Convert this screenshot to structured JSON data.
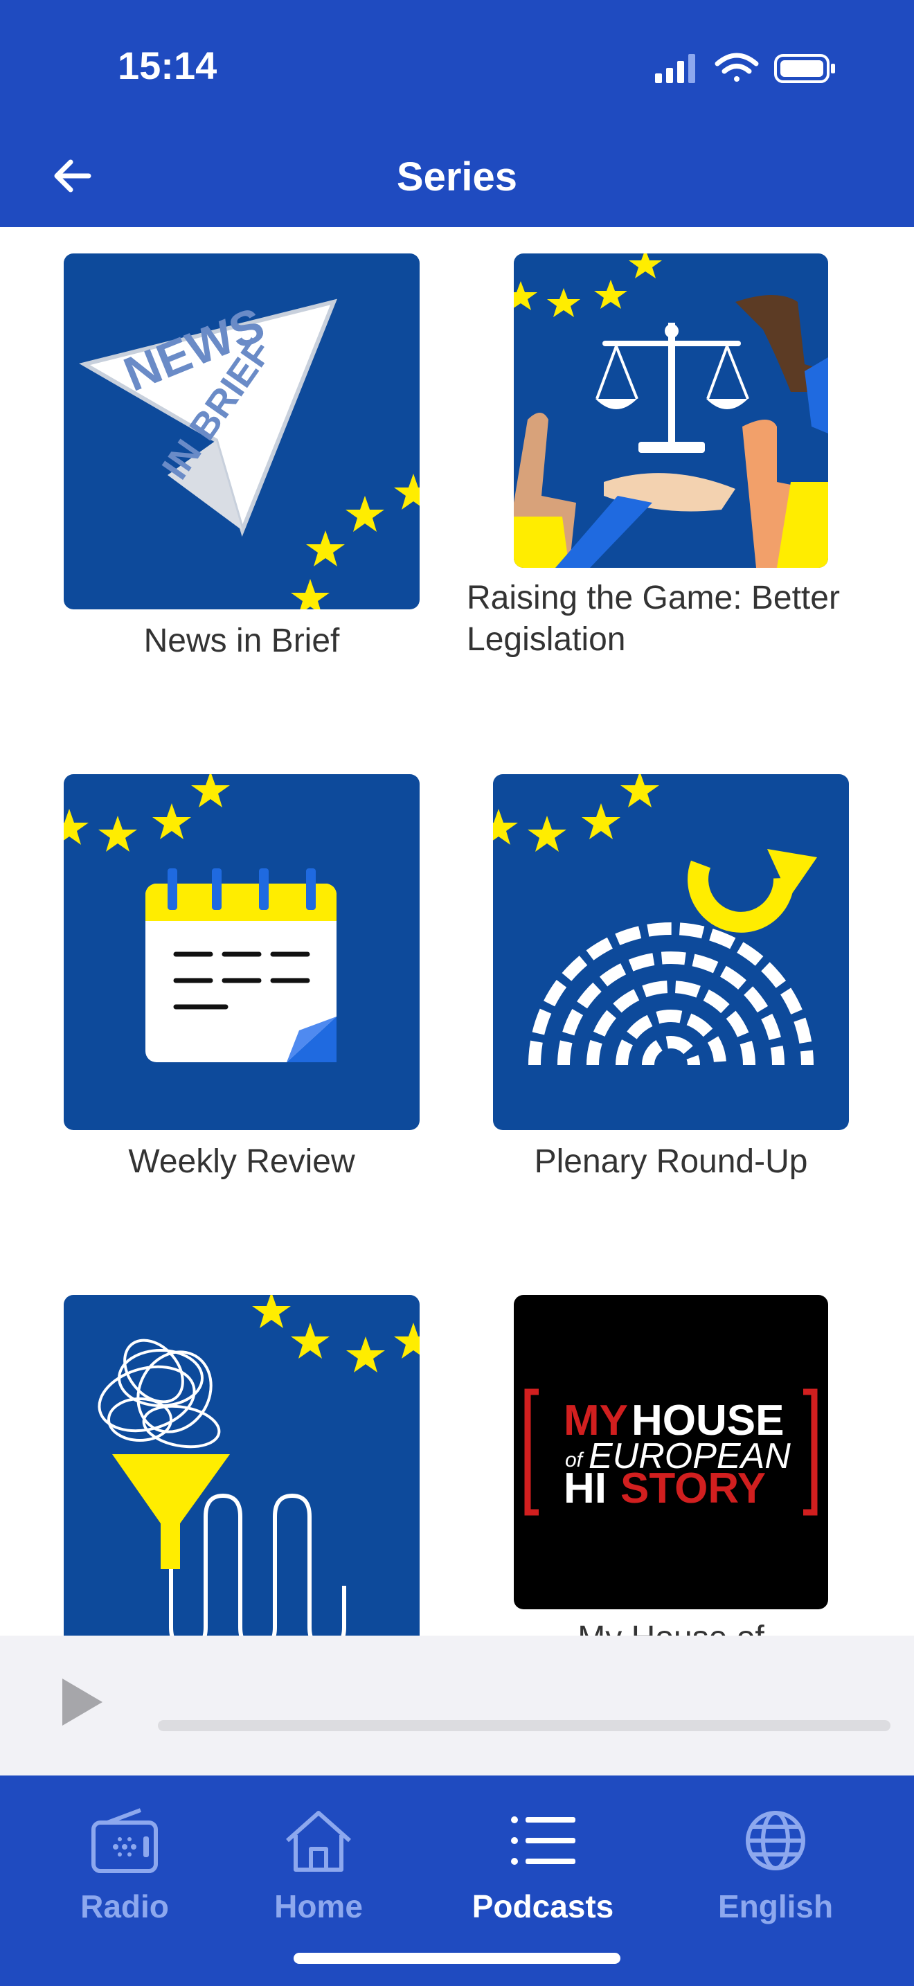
{
  "status_bar": {
    "time": "15:14"
  },
  "header": {
    "title": "Series"
  },
  "series": [
    {
      "label": "News in Brief",
      "tile_text": [
        "NEWS",
        "IN BRIEF"
      ]
    },
    {
      "label": "Raising the Game: Better Legislation"
    },
    {
      "label": "Weekly Review"
    },
    {
      "label": "Plenary Round-Up"
    },
    {
      "label": ""
    },
    {
      "label": "My House of European History",
      "tile_text": [
        "MY",
        "HOUSE",
        "of",
        "EUROPEAN",
        "HI",
        "STORY"
      ]
    }
  ],
  "player": {
    "progress": 0
  },
  "tabs": [
    {
      "label": "Radio",
      "icon": "radio-icon",
      "active": false
    },
    {
      "label": "Home",
      "icon": "home-icon",
      "active": false
    },
    {
      "label": "Podcasts",
      "icon": "list-icon",
      "active": true
    },
    {
      "label": "English",
      "icon": "globe-icon",
      "active": false
    }
  ],
  "colors": {
    "brand_blue": "#1f4bc0",
    "tile_blue": "#0d4a9b",
    "eu_yellow": "#ffed00",
    "tab_inactive": "#8da8ee"
  }
}
